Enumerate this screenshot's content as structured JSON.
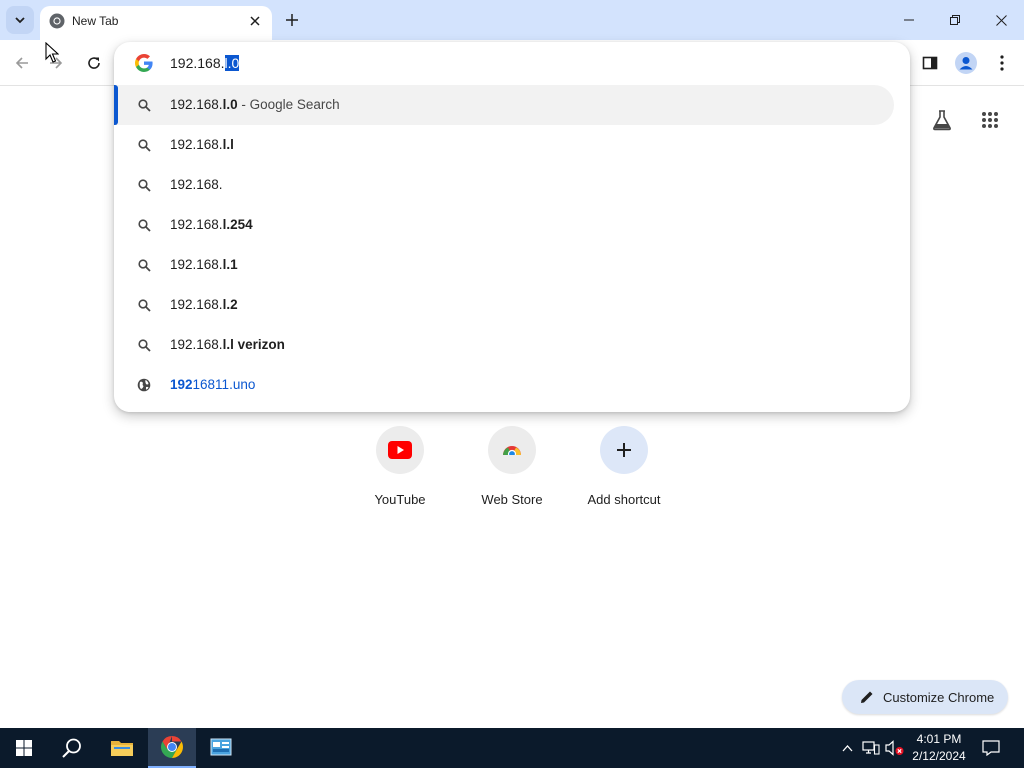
{
  "browser": {
    "tab": {
      "title": "New Tab",
      "favicon": "chrome-icon"
    },
    "icons": {
      "tab_search": "chevron-down-icon",
      "close_tab": "close-icon",
      "new_tab": "plus-icon",
      "minimize": "minimize-icon",
      "restore": "restore-icon",
      "close_window": "close-icon",
      "back": "arrow-left-icon",
      "forward": "arrow-right-icon",
      "reload": "reload-icon",
      "side_panel": "side-panel-icon",
      "profile": "profile-icon",
      "menu": "more-vert-icon"
    }
  },
  "omnibox": {
    "input_prefix": "192.168.",
    "input_selected": "l.0",
    "suggestions": [
      {
        "icon": "search-icon",
        "prefix": "192.168.",
        "bold": "l.0",
        "desc": " - Google Search",
        "highlighted": true
      },
      {
        "icon": "search-icon",
        "prefix": "192.168.",
        "bold": "l.l",
        "desc": ""
      },
      {
        "icon": "search-icon",
        "prefix": "192.168.",
        "bold": "",
        "desc": ""
      },
      {
        "icon": "search-icon",
        "prefix": "192.168.",
        "bold": "l.254",
        "desc": ""
      },
      {
        "icon": "search-icon",
        "prefix": "192.168.",
        "bold": "l.1",
        "desc": ""
      },
      {
        "icon": "search-icon",
        "prefix": "192.168.",
        "bold": "l.2",
        "desc": ""
      },
      {
        "icon": "search-icon",
        "prefix": "192.168.",
        "bold": "l.l verizon",
        "desc": ""
      },
      {
        "icon": "globe-icon",
        "bold": "192",
        "prefix": "16811.uno",
        "desc": "",
        "url": true
      }
    ]
  },
  "newtab": {
    "shortcuts": [
      {
        "label": "YouTube",
        "icon": "youtube-icon"
      },
      {
        "label": "Web Store",
        "icon": "webstore-icon"
      },
      {
        "label": "Add shortcut",
        "icon": "plus-icon"
      }
    ],
    "customize_label": "Customize Chrome",
    "labs_icon": "flask-icon",
    "apps_icon": "apps-grid-icon"
  },
  "taskbar": {
    "time": "4:01 PM",
    "date": "2/12/2024"
  },
  "colors": {
    "tabstrip": "#d3e3fd",
    "accent": "#0b57d0",
    "taskbar": "#0b1a2b"
  }
}
